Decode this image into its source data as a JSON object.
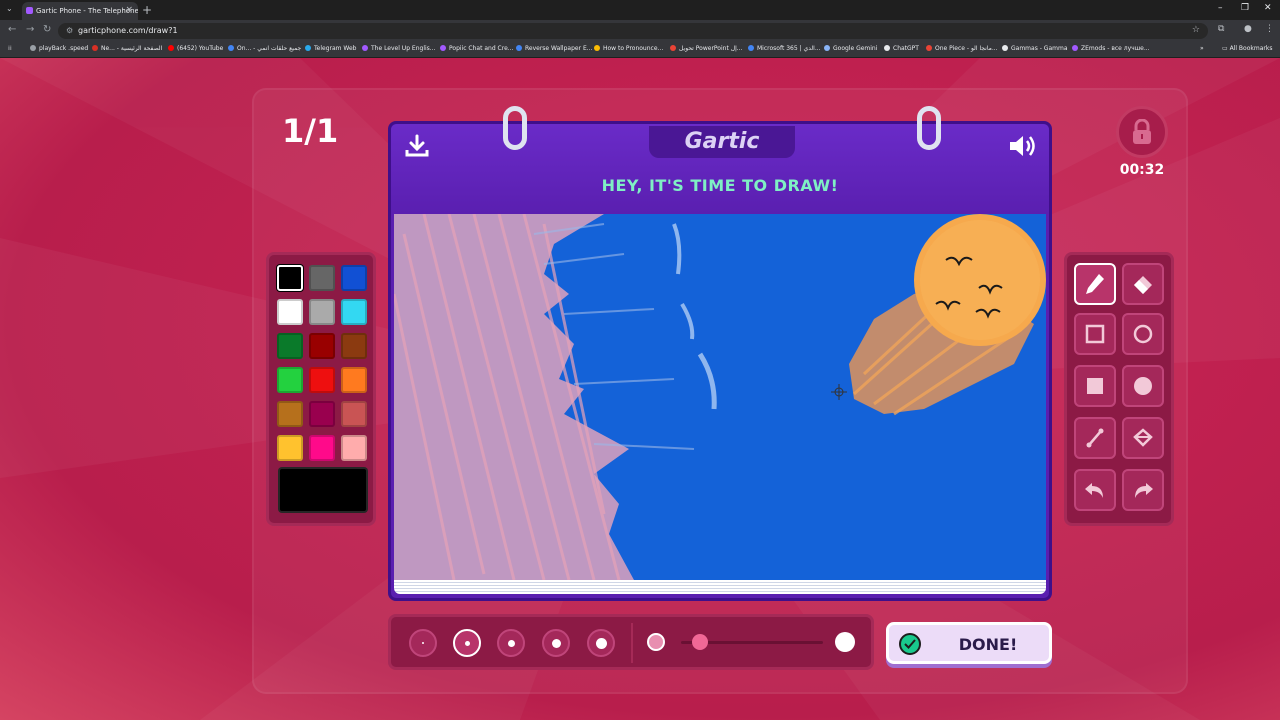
{
  "browser": {
    "tab_title": "Gartic Phone - The Telephone G",
    "url": "garticphone.com/draw?1",
    "bookmarks": [
      {
        "label": "playBack .speed",
        "color": "#9aa0a6"
      },
      {
        "label": "Ne... - الصفحة الرئيسية",
        "color": "#d93025"
      },
      {
        "label": "(6452) YouTube",
        "color": "#ff0000"
      },
      {
        "label": "On... - جميع حلقات انمي",
        "color": "#4285f4"
      },
      {
        "label": "Telegram Web",
        "color": "#29a9eb"
      },
      {
        "label": "The Level Up Englis...",
        "color": "#a259ff"
      },
      {
        "label": "Popiic Chat and Cre...",
        "color": "#a259ff"
      },
      {
        "label": "Reverse Wallpaper E...",
        "color": "#4285f4"
      },
      {
        "label": "How to Pronounce...",
        "color": "#fbbc04"
      },
      {
        "label": "تحويل PowerPoint إل...",
        "color": "#ea4335"
      },
      {
        "label": "Microsoft 365 | الدي...",
        "color": "#4285f4"
      },
      {
        "label": "Google Gemini",
        "color": "#8ab4f8"
      },
      {
        "label": "ChatGPT",
        "color": "#e8eaed"
      },
      {
        "label": "One Piece - مانجا الو...",
        "color": "#ea4335"
      },
      {
        "label": "Gammas - Gamma",
        "color": "#e8eaed"
      },
      {
        "label": "ZEmods - все лучше...",
        "color": "#a259ff"
      }
    ],
    "all_bookmarks": "All Bookmarks"
  },
  "game": {
    "round": "1/1",
    "timer": "00:32",
    "brand": "Gartic",
    "headline": "HEY, IT'S TIME TO DRAW!",
    "done_label": "DONE!",
    "selected_color": "#000000",
    "palette": [
      "#000000",
      "#666666",
      "#1150d4",
      "#ffffff",
      "#aaaaaa",
      "#33d8f2",
      "#0a7a2a",
      "#990000",
      "#8b3a10",
      "#23d13f",
      "#ee0f0f",
      "#ff7a1f",
      "#b6701c",
      "#99004e",
      "#c95454",
      "#ffc22e",
      "#ff0a8a",
      "#ffacac"
    ],
    "tools": [
      "pencil-icon",
      "eraser-icon",
      "rectangle-outline-icon",
      "ellipse-outline-icon",
      "rectangle-filled-icon",
      "ellipse-filled-icon",
      "line-icon",
      "fill-bucket-icon",
      "undo-icon",
      "redo-icon"
    ],
    "selected_tool": "pencil-icon",
    "brush_sizes": [
      1,
      2,
      3,
      4,
      5
    ],
    "selected_brush_size": 2,
    "opacity": 0.15
  }
}
